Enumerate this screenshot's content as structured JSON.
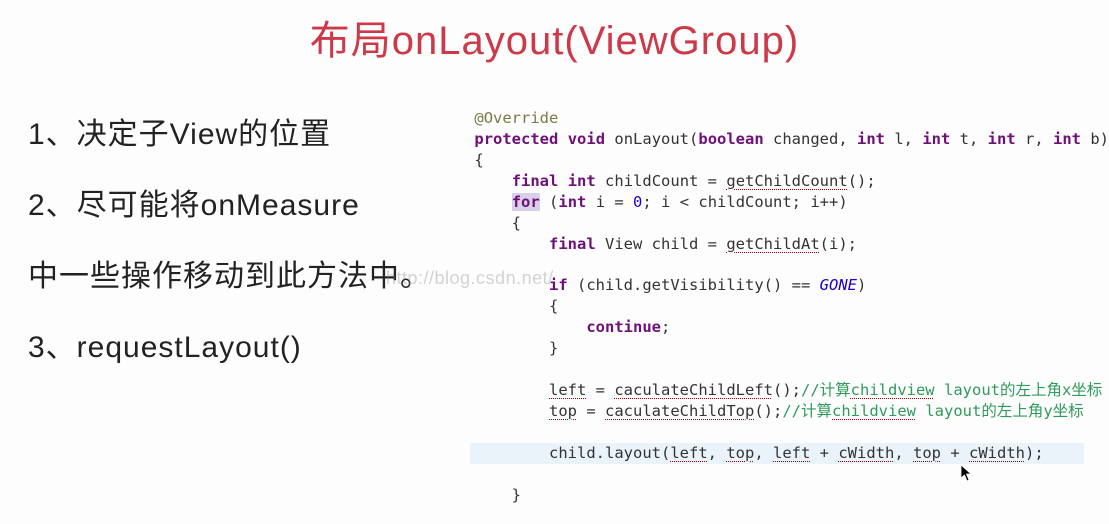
{
  "title": "布局onLayout(ViewGroup)",
  "bullets": {
    "b1": "1、决定子View的位置",
    "b2": "2、尽可能将onMeasure",
    "b2b": "中一些操作移动到此方法中。",
    "b3": "3、requestLayout()"
  },
  "code": {
    "l1_anno": "@Override",
    "l2_kw1": "protected",
    "l2_kw2": "void",
    "l2_name": " onLayout(",
    "l2_kw3": "boolean",
    "l2_p1": " changed, ",
    "l2_kw4": "int",
    "l2_p2": " l, ",
    "l2_kw5": "int",
    "l2_p3": " t, ",
    "l2_kw6": "int",
    "l2_p4": " r, ",
    "l2_kw7": "int",
    "l2_p5": " b)",
    "l3": "{",
    "l4_kw1": "final",
    "l4_kw2": "int",
    "l4_rest": " childCount = ",
    "l4_call": "getChildCount",
    "l4_end": "();",
    "l5_for": "for",
    "l5_a": " (",
    "l5_kw": "int",
    "l5_b": " i = ",
    "l5_num": "0",
    "l5_c": "; i < childCount; i++)",
    "l6": "    {",
    "l7_kw1": "final",
    "l7_a": " View child = ",
    "l7_call": "getChildAt",
    "l7_b": "(i);",
    "l8_a": "        if",
    "l8_b": " (child.getVisibility() == ",
    "l8_const": "GONE",
    "l8_c": ")",
    "l9": "        {",
    "l10_kw": "continue",
    "l10_b": ";",
    "l11": "        }",
    "l12_a": "left",
    "l12_b": " = ",
    "l12_call": "caculateChildLeft",
    "l12_c": "();",
    "l12_cm_a": "//计算",
    "l12_cm_b": "childview",
    "l12_cm_c": " layout的左上角x坐标",
    "l13_a": "top",
    "l13_b": " = ",
    "l13_call": "caculateChildTop",
    "l13_c": "();",
    "l13_cm_a": "//计算",
    "l13_cm_b": "childview",
    "l13_cm_c": " layout的左上角y坐标",
    "l14_a": "        child.layout(",
    "l14_v1": "left",
    "l14_c1": ", ",
    "l14_v2": "top",
    "l14_c2": ", ",
    "l14_v3": "left",
    "l14_c3": " + ",
    "l14_v4": "cWidth",
    "l14_c4": ", ",
    "l14_v5": "top",
    "l14_c5": " + ",
    "l14_v6": "cWidth",
    "l14_c6": ");",
    "l15": "    }"
  },
  "watermark": "http://blog.csdn.net/"
}
